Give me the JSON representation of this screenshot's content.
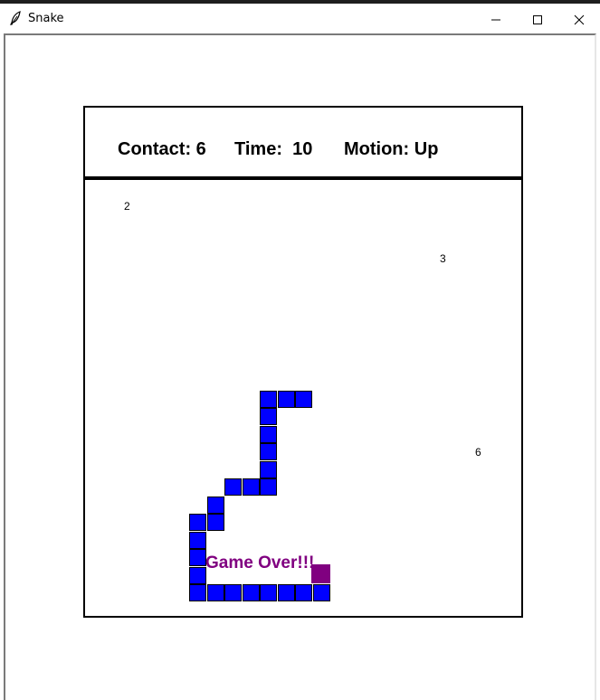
{
  "window": {
    "title": "Snake",
    "icon": "feather-icon",
    "controls": [
      "minimize-icon",
      "maximize-icon",
      "close-icon"
    ]
  },
  "hud": {
    "contact": "Contact: 6",
    "time": "Time:  10",
    "motion": "Motion: Up"
  },
  "foods": [
    {
      "value": "2"
    },
    {
      "value": "3"
    },
    {
      "value": "6"
    }
  ],
  "snake": {
    "color": "#0000ff",
    "segment_count": 24
  },
  "target": {
    "color": "#800080"
  },
  "message": "Game Over!!!",
  "message_color": "#800080"
}
